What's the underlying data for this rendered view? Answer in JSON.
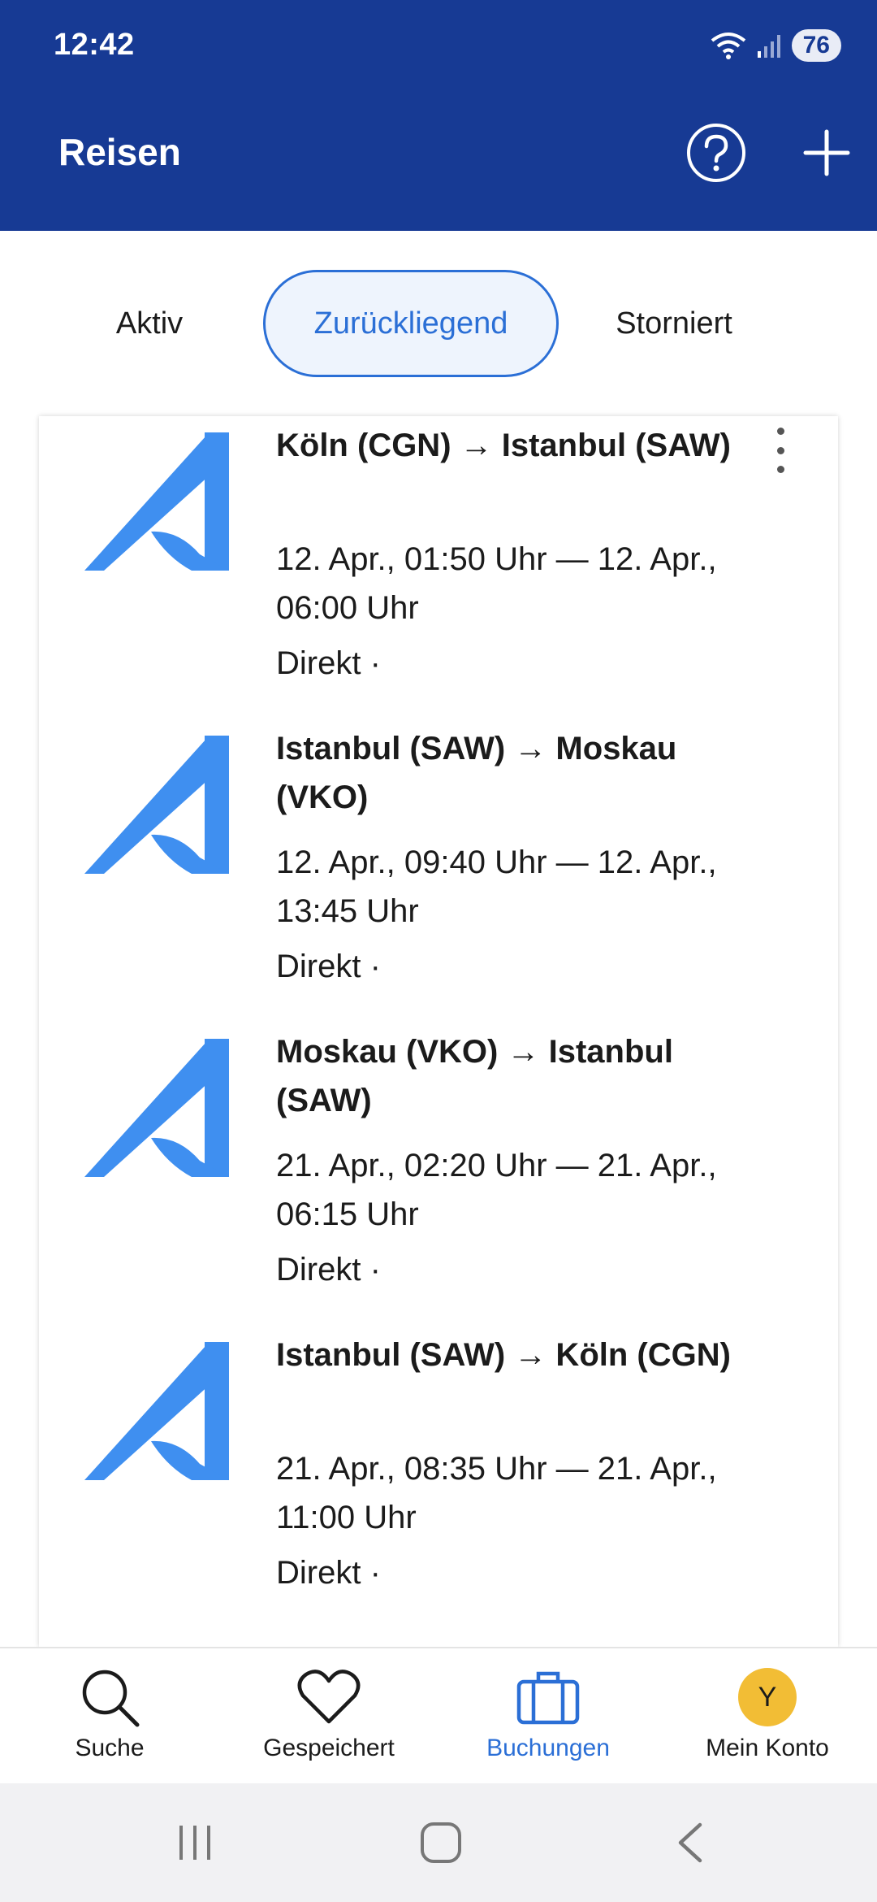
{
  "status_bar": {
    "time": "12:42",
    "battery": "76"
  },
  "header": {
    "title": "Reisen",
    "help_icon": "help-circle-icon",
    "add_icon": "plus-icon"
  },
  "tabs": [
    {
      "label": "Aktiv",
      "active": false
    },
    {
      "label": "Zurückliegend",
      "active": true
    },
    {
      "label": "Storniert",
      "active": false
    }
  ],
  "trips": [
    {
      "route": "Köln (CGN) → Istanbul (SAW)",
      "times": "12. Apr., 01:50 Uhr — 12. Apr., 06:00 Uhr",
      "stops": "Direkt ·",
      "airline_logo": "airline-logo-icon"
    },
    {
      "route": "Istanbul (SAW) → Moskau (VKO)",
      "times": "12. Apr., 09:40 Uhr — 12. Apr., 13:45 Uhr",
      "stops": "Direkt ·",
      "airline_logo": "airline-logo-icon"
    },
    {
      "route": "Moskau (VKO) → Istanbul (SAW)",
      "times": "21. Apr., 02:20 Uhr — 21. Apr., 06:15 Uhr",
      "stops": "Direkt ·",
      "airline_logo": "airline-logo-icon"
    },
    {
      "route": "Istanbul (SAW) → Köln (CGN)",
      "times": "21. Apr., 08:35 Uhr — 21. Apr., 11:00 Uhr",
      "stops": "Direkt ·",
      "airline_logo": "airline-logo-icon"
    }
  ],
  "bottom_nav": [
    {
      "label": "Suche",
      "icon": "search-icon",
      "active": false
    },
    {
      "label": "Gespeichert",
      "icon": "heart-icon",
      "active": false
    },
    {
      "label": "Buchungen",
      "icon": "briefcase-icon",
      "active": true
    },
    {
      "label": "Mein Konto",
      "icon": "avatar",
      "avatar_letter": "Y",
      "active": false
    }
  ],
  "colors": {
    "header_bg": "#173a94",
    "accent": "#2b6fd6",
    "logo_blue": "#3f8ff0",
    "avatar_bg": "#f2bd35"
  }
}
